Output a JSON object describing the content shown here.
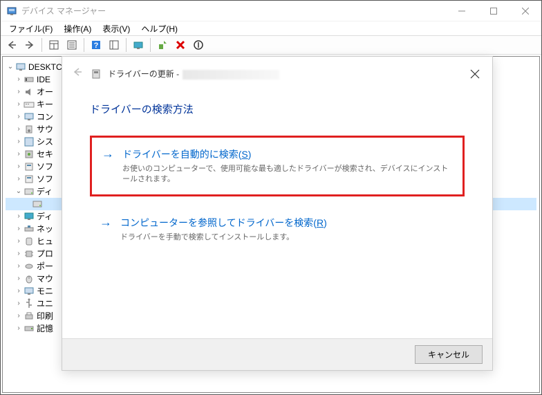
{
  "window": {
    "title": "デバイス マネージャー"
  },
  "menu": {
    "file": "ファイル(F)",
    "action": "操作(A)",
    "view": "表示(V)",
    "help": "ヘルプ(H)"
  },
  "tree": {
    "root": "DESKTC",
    "items": [
      {
        "label": "IDE",
        "icon": "ide"
      },
      {
        "label": "オー",
        "icon": "audio"
      },
      {
        "label": "キー",
        "icon": "keyboard"
      },
      {
        "label": "コン",
        "icon": "computer"
      },
      {
        "label": "サウ",
        "icon": "sound"
      },
      {
        "label": "シス",
        "icon": "system"
      },
      {
        "label": "セキ",
        "icon": "security"
      },
      {
        "label": "ソフ",
        "icon": "software"
      },
      {
        "label": "ソフ",
        "icon": "software"
      },
      {
        "label": "ディ",
        "icon": "disk",
        "expanded": true
      },
      {
        "label": "ディ",
        "icon": "display"
      },
      {
        "label": "ネッ",
        "icon": "network"
      },
      {
        "label": "ヒュ",
        "icon": "hid"
      },
      {
        "label": "プロ",
        "icon": "processor"
      },
      {
        "label": "ポー",
        "icon": "port"
      },
      {
        "label": "マウ",
        "icon": "mouse"
      },
      {
        "label": "モニ",
        "icon": "monitor"
      },
      {
        "label": "ユニ",
        "icon": "usb"
      },
      {
        "label": "印刷",
        "icon": "print"
      },
      {
        "label": "記憶",
        "icon": "storage"
      }
    ],
    "selected_child": ""
  },
  "dialog": {
    "breadcrumb": "ドライバーの更新 - ",
    "heading": "ドライバーの検索方法",
    "option1": {
      "title_prefix": "ドライバーを自動的に検索(",
      "title_key": "S",
      "title_suffix": ")",
      "desc": "お使いのコンピューターで、使用可能な最も適したドライバーが検索され、デバイスにインストールされます。"
    },
    "option2": {
      "title_prefix": "コンピューターを参照してドライバーを検索(",
      "title_key": "R",
      "title_suffix": ")",
      "desc": "ドライバーを手動で検索してインストールします。"
    },
    "cancel": "キャンセル"
  }
}
